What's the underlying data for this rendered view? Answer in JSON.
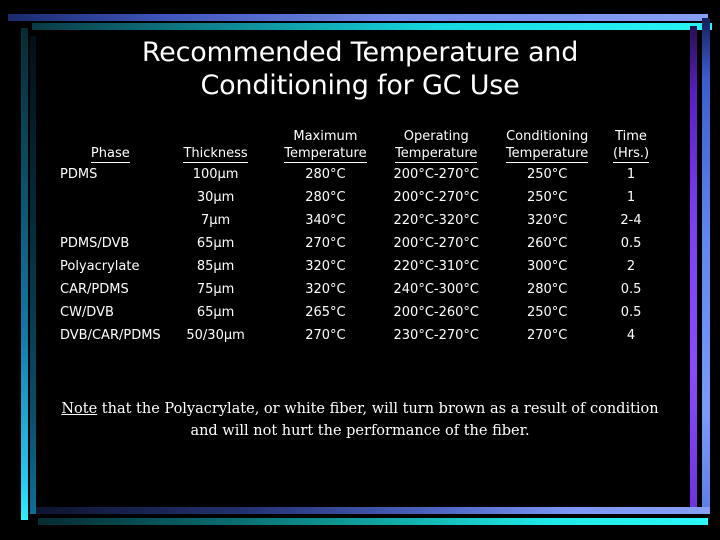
{
  "slide": {
    "title": "Recommended Temperature and Conditioning for GC Use"
  },
  "table": {
    "headers": [
      {
        "top": "",
        "bottom": "Phase"
      },
      {
        "top": "",
        "bottom": "Thickness"
      },
      {
        "top": "Maximum",
        "bottom": "Temperature"
      },
      {
        "top": "Operating",
        "bottom": "Temperature"
      },
      {
        "top": "Conditioning",
        "bottom": "Temperature"
      },
      {
        "top": "Time",
        "bottom": "(Hrs.)"
      }
    ],
    "rows": [
      {
        "phase": "PDMS",
        "thickness": "100µm",
        "max_temp": "280°C",
        "operating_temp": "200°C-270°C",
        "conditioning_temp": "250°C",
        "time": "1"
      },
      {
        "phase": "",
        "thickness": "30µm",
        "max_temp": "280°C",
        "operating_temp": "200°C-270°C",
        "conditioning_temp": "250°C",
        "time": "1"
      },
      {
        "phase": "",
        "thickness": "7µm",
        "max_temp": "340°C",
        "operating_temp": "220°C-320°C",
        "conditioning_temp": "320°C",
        "time": "2-4"
      },
      {
        "phase": "PDMS/DVB",
        "thickness": "65µm",
        "max_temp": "270°C",
        "operating_temp": "200°C-270°C",
        "conditioning_temp": "260°C",
        "time": "0.5"
      },
      {
        "phase": "Polyacrylate",
        "thickness": "85µm",
        "max_temp": "320°C",
        "operating_temp": "220°C-310°C",
        "conditioning_temp": "300°C",
        "time": "2"
      },
      {
        "phase": "CAR/PDMS",
        "thickness": "75µm",
        "max_temp": "320°C",
        "operating_temp": "240°C-300°C",
        "conditioning_temp": "280°C",
        "time": "0.5"
      },
      {
        "phase": "CW/DVB",
        "thickness": "65µm",
        "max_temp": "265°C",
        "operating_temp": "200°C-260°C",
        "conditioning_temp": "250°C",
        "time": "0.5"
      },
      {
        "phase": "DVB/CAR/PDMS",
        "thickness": "50/30µm",
        "max_temp": "270°C",
        "operating_temp": "230°C-270°C",
        "conditioning_temp": "270°C",
        "time": "4"
      }
    ]
  },
  "note": {
    "lead": "Note",
    "body": " that the Polyacrylate, or white fiber, will turn brown as a result of condition and will not hurt the performance of the fiber."
  },
  "colors": {
    "background": "#000000",
    "text": "#ffffff",
    "accent_cyan": "#29f6f6",
    "accent_blue": "#86a0f5",
    "accent_purple": "#8a4bff",
    "accent_teal": "#12b0ac"
  }
}
